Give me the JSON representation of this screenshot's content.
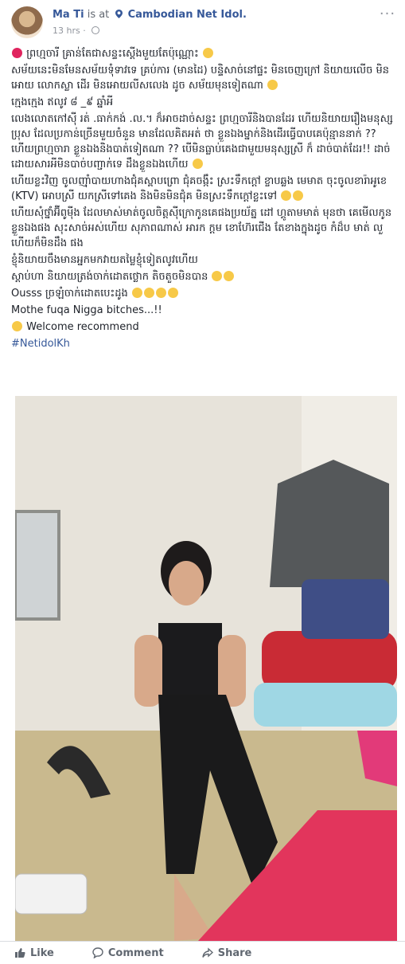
{
  "post": {
    "author": "Ma Ti",
    "is_at": "is at",
    "place": "Cambodian Net Idol.",
    "time": "13 hrs",
    "more": "···",
    "lines": [
      "ព្រហ្មចារី គ្រាន់តែជាសន្ទះស្ដើងមួយតែប៉ុណ្ណោះ",
      "សម័យនេះមិនមែនសម័យទុំទាវទេ គ្រប់ការ (មានដៃ) បន្ទិសាច់នៅផ្ទះ មិនចេញក្រៅ និយាយលើច មិនអោយ លោកស្លា ដើរ មិនអោយលីសលេង ដូច សម័យមុនទៀតណា",
      "ក្មេងក្មេង ឥលូវ ៨ _៩ ឆ្នាំអី",
      "លេងលោតកៅស៊ី រត់ .ធាក់កង់ .ល.។ ក៏អាចដាច់សន្ទះ ព្រហ្មចារីនិងបានដែរ ហើយនិយាយរឿងមនុស្សប្រុស ដែលប្រកាន់ច្រើនមួយចំនួន មានដែលគិតអត់ ថា ខ្លួនឯងម្នាក់និងដើរធ្វើបាបគេប៉ុន្មាននាក់ ?? ហើយព្រហ្មចារា ខ្លួនឯងនិងបាត់ទៀតណា ?? បើមិនធ្លាប់គេងជាមួយមនុស្សស្រី ក៏ ដាច់បាត់ដែរ!! ដាច់ដោយសារអីមិនបាច់បញ្ជាក់ទេ ដឹងខ្លួនឯងហើយ",
      "ហើយខ្លះវិញ ចូលញ៉ាំបាយហាងជុំគស្ពាបព្រោ ជុំគចង្កឹះ ស្រះទឹកក្ដៅ ខ្ចាបឆ្លង មេមាត ចុះចូលខារ៉ាអូខេ (KTV) អោបស្រី យកស្រីទៅគេង និងមិនមិនជុំគ មិនស្រះទឹកក្ដៅខ្លះទៅ",
      "ហើយសុំថ្នាំអ៊ីពូម៉ីង ដែលមាស់មាត់ចូលចិត្តស៊ីក្រោកូនគេផងប្រយ័ត្ន ដៅ ហ្គូតាមមាត់ មុនថា គេមើលកូនខ្លួនឯងផង សុះសាច់អស់ហើយ សុភាពណាស់ អារក ក្ដម ខោហ៊ែរជើង តែខាងក្នុងដូច កំដ៏ប មាត់ លួ ហើយក៏មិនដឹង ផង",
      "ខ្ញុំនិយាយចឹងមានអ្នកមកវាយតម្លៃខ្ញុំទៀតលូវហើយ",
      "ស្ដាប់ហា និយាយត្រង់ចាក់ដោតថ្លោក តិចតួចមិនបាន",
      "Ousss ច្រឡំចាក់ដោតបេះដូង",
      "Mothe fuqa Nigga bitches...!!",
      "Welcome recommend",
      "#NetidolKh"
    ]
  },
  "actions": {
    "like": "Like",
    "comment": "Comment",
    "share": "Share"
  },
  "colors": {
    "link": "#365899",
    "muted": "#90949c",
    "action": "#606770"
  }
}
